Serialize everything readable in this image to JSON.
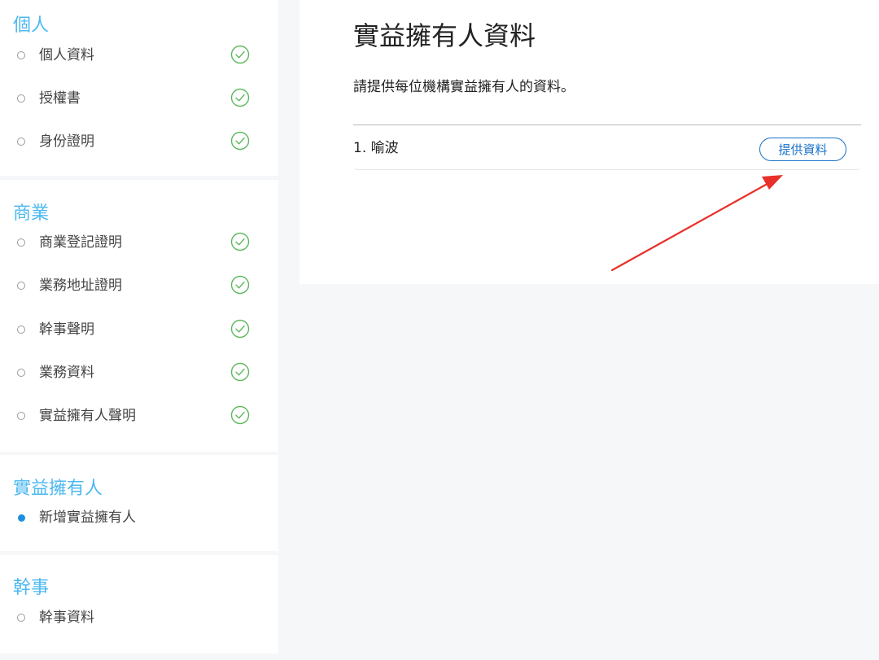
{
  "sidebar": {
    "sections": [
      {
        "title": "個人",
        "items": [
          {
            "label": "個人資料",
            "done": true
          },
          {
            "label": "授權書",
            "done": true
          },
          {
            "label": "身份證明",
            "done": true
          }
        ]
      },
      {
        "title": "商業",
        "items": [
          {
            "label": "商業登記證明",
            "done": true
          },
          {
            "label": "業務地址證明",
            "done": true
          },
          {
            "label": "幹事聲明",
            "done": true
          },
          {
            "label": "業務資料",
            "done": true
          },
          {
            "label": "實益擁有人聲明",
            "done": true
          }
        ]
      },
      {
        "title": "實益擁有人",
        "items": [
          {
            "label": "新增實益擁有人",
            "done": false,
            "active": true
          }
        ]
      },
      {
        "title": "幹事",
        "items": [
          {
            "label": "幹事資料",
            "done": false
          }
        ]
      }
    ]
  },
  "main": {
    "title": "實益擁有人資料",
    "description": "請提供每位機構實益擁有人的資料。",
    "owners": [
      {
        "name": "1. 喻波",
        "action_label": "提供資料"
      }
    ]
  },
  "colors": {
    "section_title": "#4db8f0",
    "check": "#5cb85c",
    "button": "#1a73c8",
    "arrow": "#e8302a",
    "active_dot": "#1a8fe0"
  },
  "icons": {
    "completed": "check-circle-icon",
    "pending": "empty-circle-icon",
    "current": "filled-circle-icon"
  }
}
